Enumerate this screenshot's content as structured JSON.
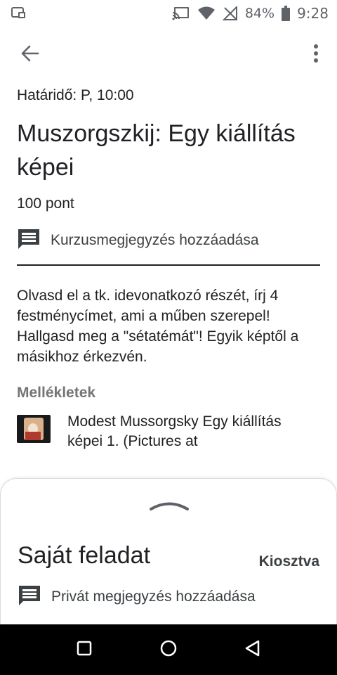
{
  "status_bar": {
    "battery_percent": "84%",
    "time": "9:28",
    "icons": [
      "screenshot-icon",
      "cast-icon",
      "wifi-icon",
      "no-signal-icon",
      "battery-icon"
    ]
  },
  "app_bar": {
    "icons": [
      "back-arrow-icon",
      "more-vert-icon"
    ]
  },
  "assignment": {
    "due": "Határidő: P, 10:00",
    "title": "Muszorgszkij: Egy kiállítás képei",
    "points": "100 pont",
    "class_comment_label": "Kurzusmegjegyzés hozzáadása",
    "description": "Olvasd el a tk. idevonatkozó részét, írj 4 festménycímet, ami a műben szerepel! Hallgasd meg a \"sétatémát\"! Egyik képtől a másikhoz érkezvén."
  },
  "attachments": {
    "header": "Mellékletek",
    "items": [
      {
        "title": "Modest Mussorgsky Egy kiállítás képei 1. (Pictures at"
      }
    ]
  },
  "bottom_sheet": {
    "title": "Saját feladat",
    "status": "Kiosztva",
    "private_comment_label": "Privát megjegyzés hozzáadása"
  },
  "nav_bar": {
    "icons": [
      "recents-square-icon",
      "home-circle-icon",
      "back-triangle-icon"
    ]
  },
  "colors": {
    "text_primary": "#202124",
    "text_secondary": "#757575",
    "status_icons": "#5f6368",
    "nav_bar": "#000000"
  }
}
